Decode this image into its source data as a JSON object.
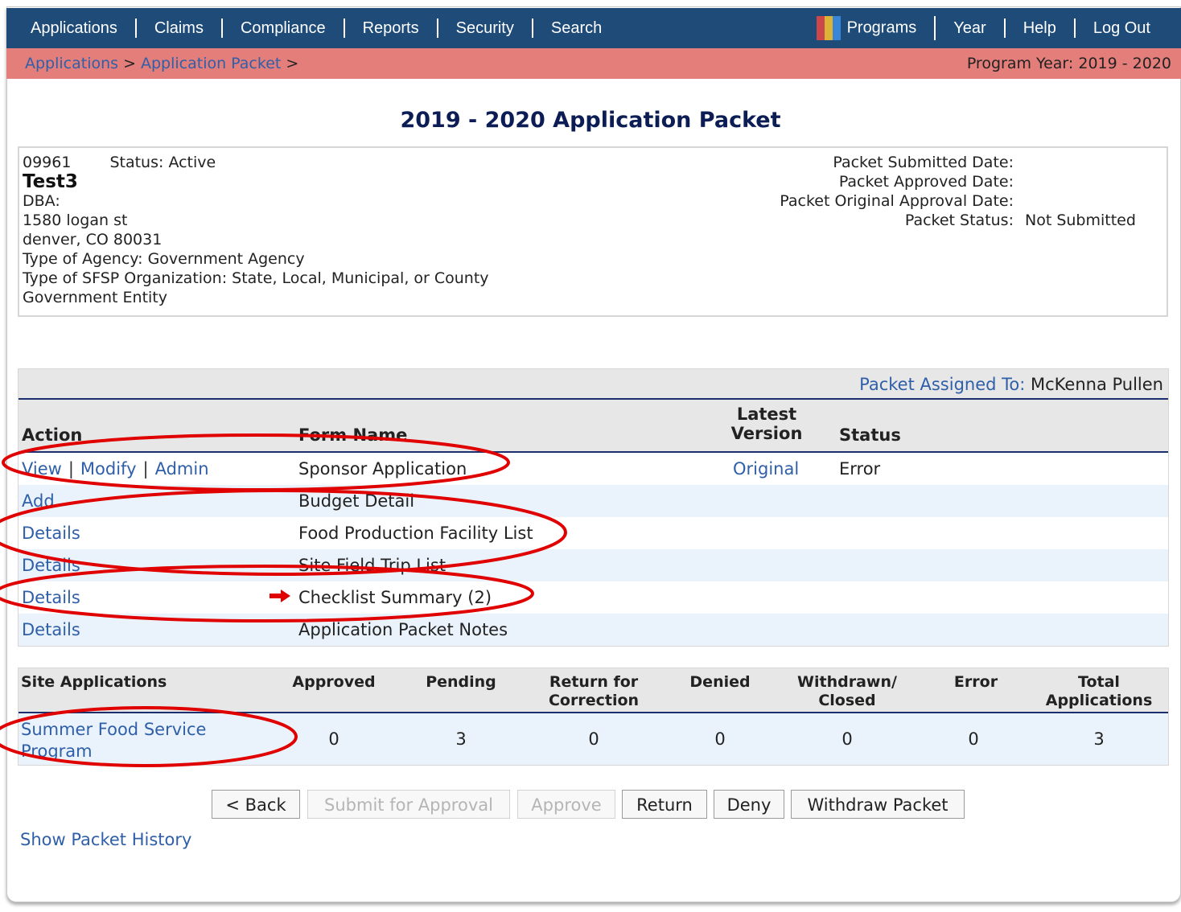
{
  "nav": {
    "left_items": [
      "Applications",
      "Claims",
      "Compliance",
      "Reports",
      "Security",
      "Search"
    ],
    "programs": "Programs",
    "year": "Year",
    "help": "Help",
    "logout": "Log Out"
  },
  "breadcrumb": {
    "items": [
      "Applications",
      "Application Packet"
    ],
    "separator": ">",
    "program_year": "Program Year: 2019 - 2020"
  },
  "page_title": "2019 - 2020 Application Packet",
  "sponsor": {
    "id": "09961",
    "status": "Status: Active",
    "name": "Test3",
    "dba": "DBA:",
    "address1": "1580 logan st",
    "address2": "denver, CO 80031",
    "agency_type": "Type of Agency: Government Agency",
    "org_type_line1": "Type of SFSP Organization: State, Local, Municipal, or County",
    "org_type_line2": "Government Entity"
  },
  "packet_info": {
    "submitted_label": "Packet Submitted Date:",
    "submitted_value": "",
    "approved_label": "Packet Approved Date:",
    "approved_value": "",
    "original_label": "Packet Original Approval Date:",
    "original_value": "",
    "status_label": "Packet Status:",
    "status_value": "Not Submitted"
  },
  "forms": {
    "assigned_label": "Packet Assigned To:",
    "assigned_name": "McKenna Pullen",
    "headers": {
      "action": "Action",
      "form_name": "Form Name",
      "latest1": "Latest",
      "latest2": "Version",
      "status": "Status"
    },
    "rows": [
      {
        "actions": [
          "View",
          "Modify",
          "Admin"
        ],
        "form": "Sponsor Application",
        "version": "Original",
        "status": "Error"
      },
      {
        "actions": [
          "Add"
        ],
        "form": "Budget Detail",
        "version": "",
        "status": ""
      },
      {
        "actions": [
          "Details"
        ],
        "form": "Food Production Facility List",
        "version": "",
        "status": ""
      },
      {
        "actions": [
          "Details"
        ],
        "form": "Site Field Trip List",
        "version": "",
        "status": ""
      },
      {
        "actions": [
          "Details"
        ],
        "form": "Checklist Summary (2)",
        "version": "",
        "status": ""
      },
      {
        "actions": [
          "Details"
        ],
        "form": "Application Packet Notes",
        "version": "",
        "status": ""
      }
    ]
  },
  "sites": {
    "headers": {
      "site": "Site Applications",
      "approved": "Approved",
      "pending": "Pending",
      "return1": "Return for",
      "return2": "Correction",
      "denied": "Denied",
      "withdrawn1": "Withdrawn/",
      "withdrawn2": "Closed",
      "error": "Error",
      "total1": "Total",
      "total2": "Applications"
    },
    "row": {
      "program_line1": "Summer Food Service",
      "program_line2": "Program",
      "approved": "0",
      "pending": "3",
      "return": "0",
      "denied": "0",
      "withdrawn": "0",
      "error": "0",
      "total": "3"
    }
  },
  "buttons": {
    "back": "< Back",
    "submit": "Submit for Approval",
    "approve": "Approve",
    "return": "Return",
    "deny": "Deny",
    "withdraw": "Withdraw Packet"
  },
  "history_link": "Show Packet History",
  "colors": {
    "nav_bg": "#1e4b78",
    "breadcrumb_bg": "#e47e7b",
    "link": "#2f5fa8",
    "annotation": "#e00000"
  }
}
